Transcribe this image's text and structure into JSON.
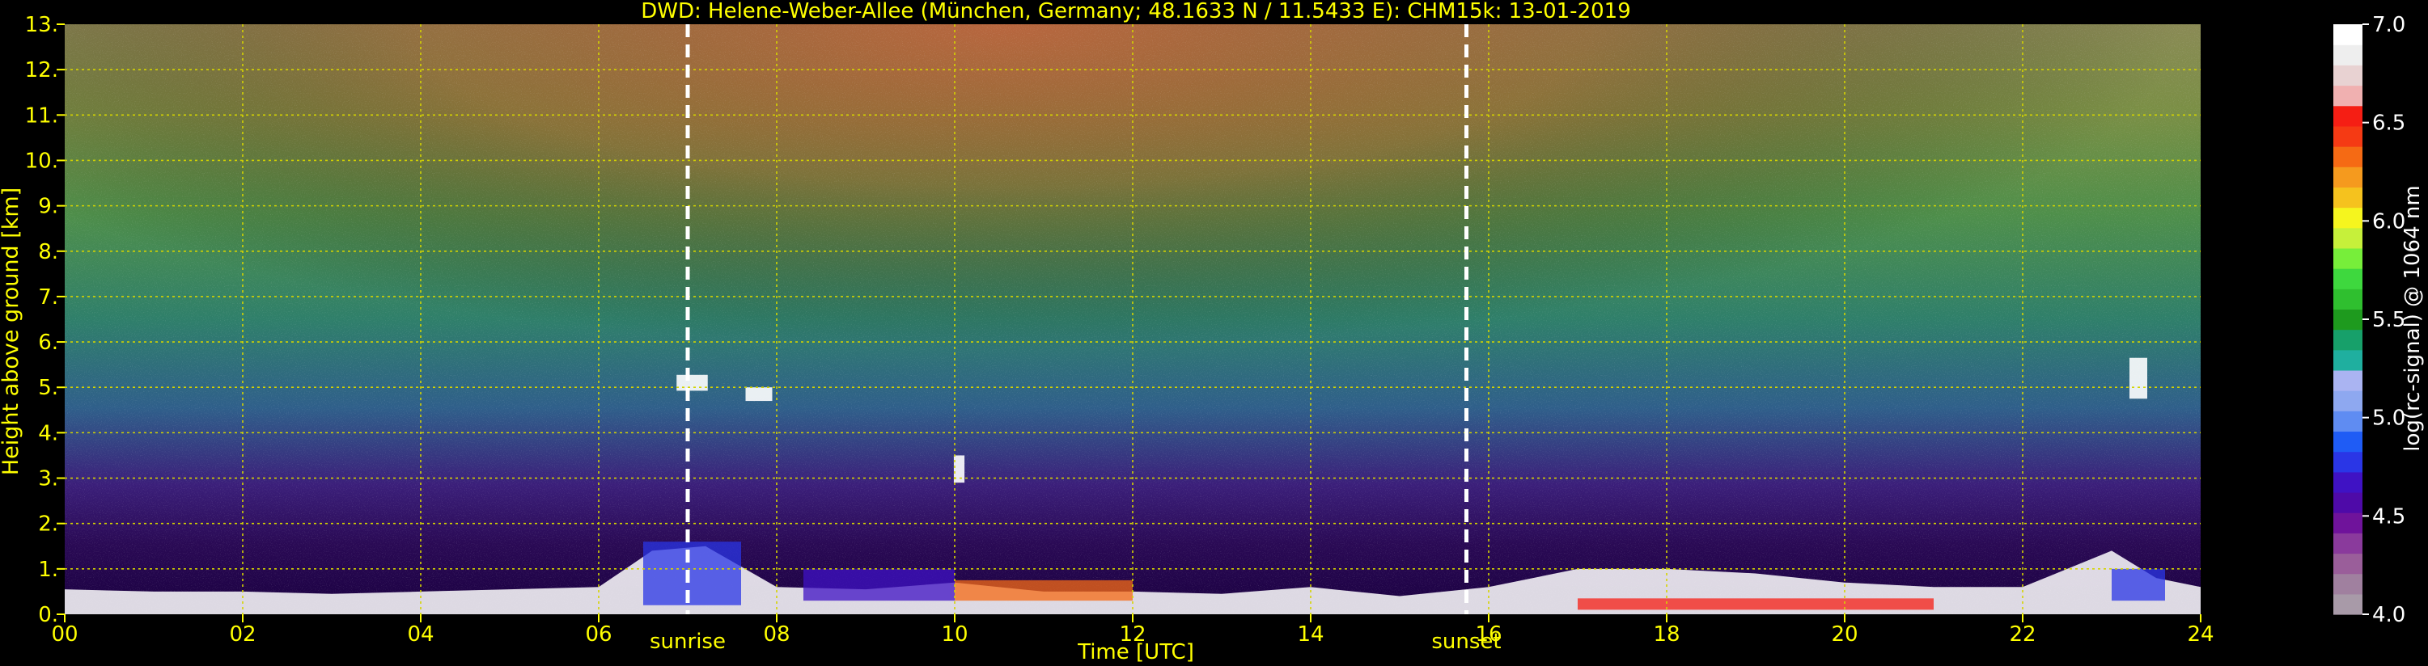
{
  "chart_data": {
    "type": "heatmap",
    "title": "DWD: Helene-Weber-Allee (München, Germany; 48.1633 N / 11.5433 E):    CHM15k: 13-01-2019",
    "xlabel": "Time [UTC]",
    "ylabel": "Height above ground [km]",
    "xlim": [
      0,
      24
    ],
    "ylim": [
      0,
      13
    ],
    "x_ticks": [
      "00",
      "02",
      "04",
      "06",
      "08",
      "10",
      "12",
      "14",
      "16",
      "18",
      "20",
      "22",
      "24"
    ],
    "y_ticks": [
      "0.",
      "1.",
      "2.",
      "3.",
      "4.",
      "5.",
      "6.",
      "7.",
      "8.",
      "9.",
      "10.",
      "11.",
      "12.",
      "13."
    ],
    "grid": true,
    "markers": [
      {
        "label": "sunrise",
        "time_utc": 7.0
      },
      {
        "label": "sunset",
        "time_utc": 15.75
      }
    ],
    "colorbar": {
      "label": "log(rc-signal) @ 1064 nm",
      "min": 4.0,
      "max": 7.0,
      "ticks": [
        "4.0",
        "4.5",
        "5.0",
        "5.5",
        "6.0",
        "6.5",
        "7.0"
      ],
      "colors": [
        "#a89aa8",
        "#a0809f",
        "#9a5e9a",
        "#8a3a9c",
        "#6f139b",
        "#4e0aa8",
        "#3f12c4",
        "#2a36e6",
        "#1f5cf5",
        "#5f8cf2",
        "#8ea8f0",
        "#aab4f2",
        "#1faf9f",
        "#17a06a",
        "#1e9a1e",
        "#2fbf2f",
        "#3ed83e",
        "#77ee3a",
        "#c6f03a",
        "#f5f51e",
        "#f5c21e",
        "#f59a1e",
        "#f56a14",
        "#f53a14",
        "#f51e14",
        "#f0b0b0",
        "#e8d2d2",
        "#eeeeee",
        "#ffffff"
      ]
    }
  }
}
